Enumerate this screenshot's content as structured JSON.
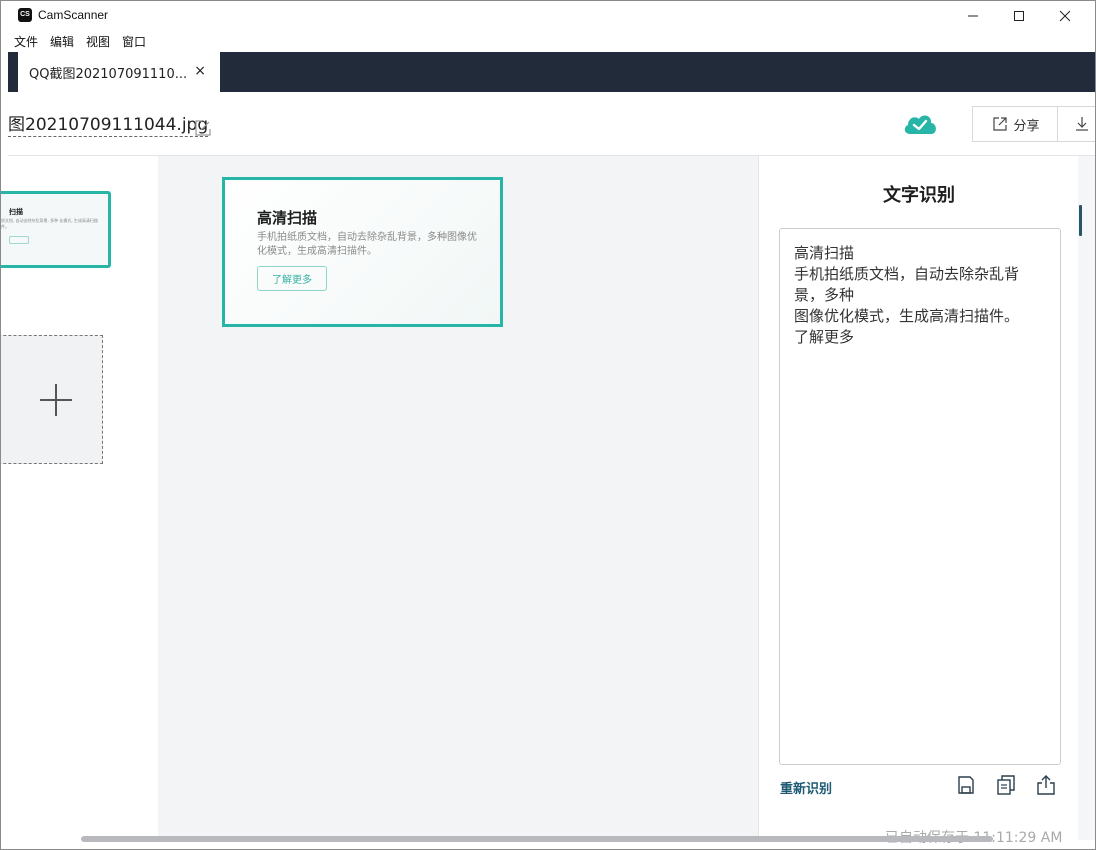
{
  "app": {
    "logo_text": "CS",
    "title": "CamScanner"
  },
  "menu": [
    "文件",
    "编辑",
    "视图",
    "窗口"
  ],
  "tab": {
    "label": "QQ截图202107091110...",
    "close_label": "×"
  },
  "file": {
    "name": "图20210709111044.jpg"
  },
  "header": {
    "share_label": "分享",
    "sync_status_icon": "cloud-check-icon"
  },
  "thumbnail": {
    "title": "扫描",
    "desc": "质文档, 自动去除杂乱背景, 多种 化模式, 生成高清扫描件。"
  },
  "preview": {
    "title": "高清扫描",
    "desc": "手机拍纸质文档，自动去除杂乱背景，多种图像优化模式，生成高清扫描件。",
    "button": "了解更多"
  },
  "ocr": {
    "title": "文字识别",
    "lines": [
      "高清扫描",
      "手机拍纸质文档，自动去除杂乱背",
      "景，多种",
      "图像优化模式，生成高清扫描件。",
      "了解更多"
    ],
    "reocr_label": "重新识别",
    "autosave": "已自动保存于 11:11:29 AM"
  },
  "colors": {
    "accent": "#26b5a6",
    "tabbar": "#212b3a",
    "link": "#1f5a74"
  }
}
